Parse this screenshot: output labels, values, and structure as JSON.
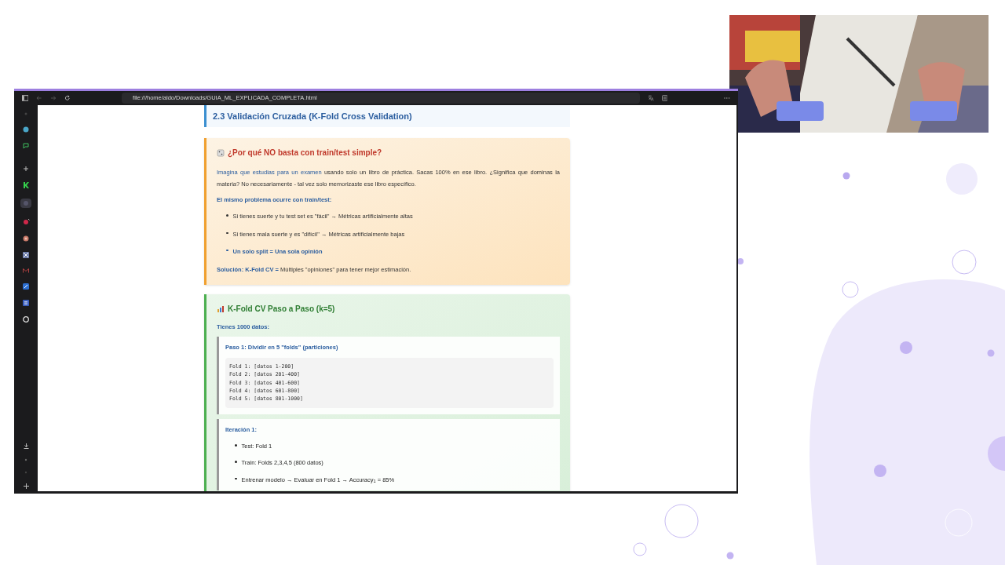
{
  "browser": {
    "url": "file:///home/aldo/Downloads/GUIA_ML_EXPLICADA_COMPLETA.html"
  },
  "section_title": "2.3 Validación Cruzada (K-Fold Cross Validation)",
  "warning_card": {
    "title": "¿Por qué NO basta con train/test simple?",
    "paragraph": "**Imagina que estudias para un examen** usando solo un libro de práctica. Sacas 100% en ese libro. ¿Significa que dominas la materia? No necesariamente - tal vez solo memorizaste ese libro específico.",
    "subtitle": "El mismo problema ocurre con train/test:",
    "bullets": [
      {
        "text": "Si tienes suerte y tu test set es \"fácil\" → Métricas artificialmente altas",
        "highlight": false
      },
      {
        "text": "Si tienes mala suerte y es \"difícil\" → Métricas artificialmente bajas",
        "highlight": false
      },
      {
        "text": "Un solo split = Una sola opinión",
        "highlight": true
      }
    ],
    "solution": "**Solución: K-Fold CV =** Múltiples \"opiniones\" para tener mejor estimación."
  },
  "steps_card": {
    "title": "K-Fold CV Paso a Paso (k=5)",
    "intro": "Tienes 1000 datos:",
    "boxes": [
      {
        "kind": "code",
        "title": "Paso 1: Dividir en 5 \"folds\" (particiones)",
        "lines": [
          "Fold 1: [datos 1-200]",
          "Fold 2: [datos 201-400]",
          "Fold 3: [datos 401-600]",
          "Fold 4: [datos 601-800]",
          "Fold 5: [datos 801-1000]"
        ]
      },
      {
        "kind": "list",
        "title": "Iteración 1:",
        "items": [
          "Test: Fold 1",
          "Train: Folds 2,3,4,5 (800 datos)",
          "Entrenar modelo → Evaluar en Fold 1 → Accuracy$_{1}$ = 85%"
        ]
      }
    ]
  }
}
